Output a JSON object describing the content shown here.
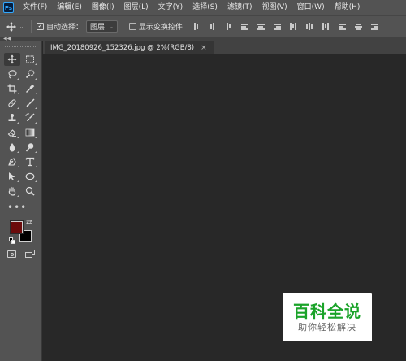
{
  "app": {
    "logo": "Ps"
  },
  "menu": [
    "文件(F)",
    "编辑(E)",
    "图像(I)",
    "图层(L)",
    "文字(Y)",
    "选择(S)",
    "滤镜(T)",
    "视图(V)",
    "窗口(W)",
    "帮助(H)"
  ],
  "options_bar": {
    "tool_icon": "move-icon",
    "auto_select_label": "自动选择：",
    "auto_select_checked": true,
    "auto_select_target": "图层",
    "show_transform_label": "显示变换控件",
    "show_transform_checked": false,
    "align_icons": [
      "align-top-icon",
      "align-vcenter-icon",
      "align-bottom-icon",
      "align-left-icon",
      "align-hcenter-icon",
      "align-right-icon",
      "distribute-top-icon",
      "distribute-vcenter-icon",
      "distribute-bottom-icon",
      "distribute-left-icon",
      "distribute-hcenter-icon",
      "distribute-right-icon"
    ]
  },
  "document": {
    "tab_title": "IMG_20180926_152326.jpg @ 2%(RGB/8)",
    "close_glyph": "×"
  },
  "tools": [
    "move-tool-icon",
    "marquee-tool-icon",
    "lasso-tool-icon",
    "quick-select-tool-icon",
    "crop-tool-icon",
    "eyedropper-tool-icon",
    "healing-brush-tool-icon",
    "brush-tool-icon",
    "clone-stamp-tool-icon",
    "history-brush-tool-icon",
    "eraser-tool-icon",
    "gradient-tool-icon",
    "blur-tool-icon",
    "dodge-tool-icon",
    "pen-tool-icon",
    "type-tool-icon",
    "path-select-tool-icon",
    "ellipse-tool-icon",
    "hand-tool-icon",
    "zoom-tool-icon"
  ],
  "more_tools": "•••",
  "colors": {
    "foreground": "#6b0b0b",
    "background": "#000000",
    "accent": "#31a8ff"
  },
  "watermark": {
    "title": "百科全说",
    "subtitle": "助你轻松解决"
  }
}
